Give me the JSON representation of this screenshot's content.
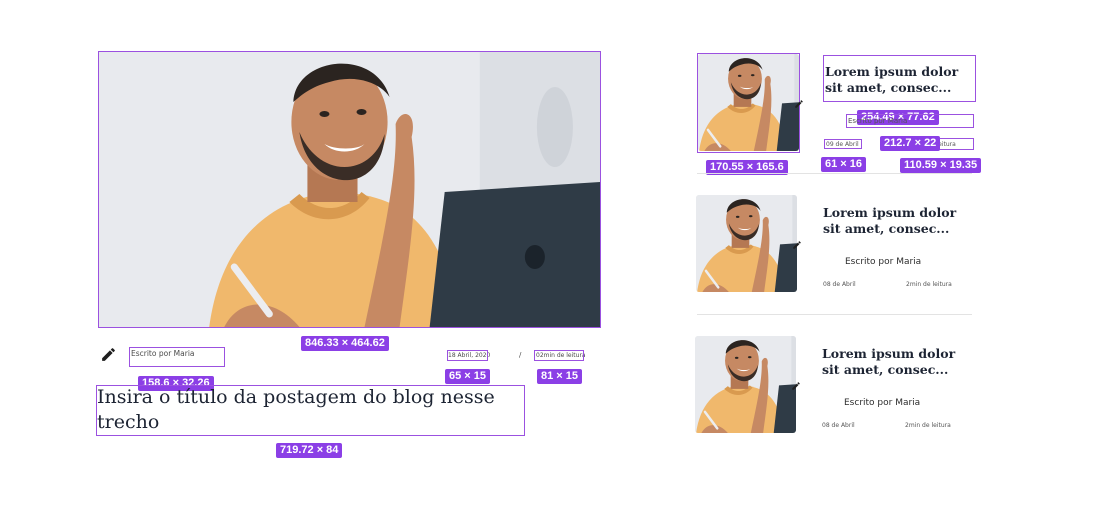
{
  "main_post": {
    "title": "Insira o título da postagem do blog nesse trecho",
    "author": "Escrito por Maria",
    "date": "18 Abril, 2020",
    "separator": "/",
    "read_time": "02min de leitura",
    "edit_icon": "pencil-icon"
  },
  "side_posts": [
    {
      "title": "Lorem ipsum dolor sit amet, consec...",
      "author": "Escrito por Maria",
      "date": "09 de Abril",
      "read_time": "2min de leitura"
    },
    {
      "title": "Lorem ipsum dolor sit amet, consec...",
      "author": "Escrito por Maria",
      "date": "08 de Abril",
      "read_time": "2min de leitura"
    },
    {
      "title": "Lorem ipsum dolor sit amet, consec...",
      "author": "Escrito por Maria",
      "date": "08 de Abril",
      "read_time": "2min de leitura"
    }
  ],
  "measurements": {
    "main_image": "846.33 × 464.62",
    "author": "158.6 × 32.26",
    "date": "65 × 15",
    "read_time": "81 × 15",
    "title": "719.72 × 84",
    "side_image": "170.55 × 165.6",
    "side_title": "254.49 × 77.62",
    "side_author": "212.7 × 22",
    "side_date": "61 × 16",
    "side_read_time": "110.59 × 19.35"
  },
  "colors": {
    "selection": "#9b51e0",
    "badge": "#8b3fe6",
    "text": "#1d2433"
  }
}
